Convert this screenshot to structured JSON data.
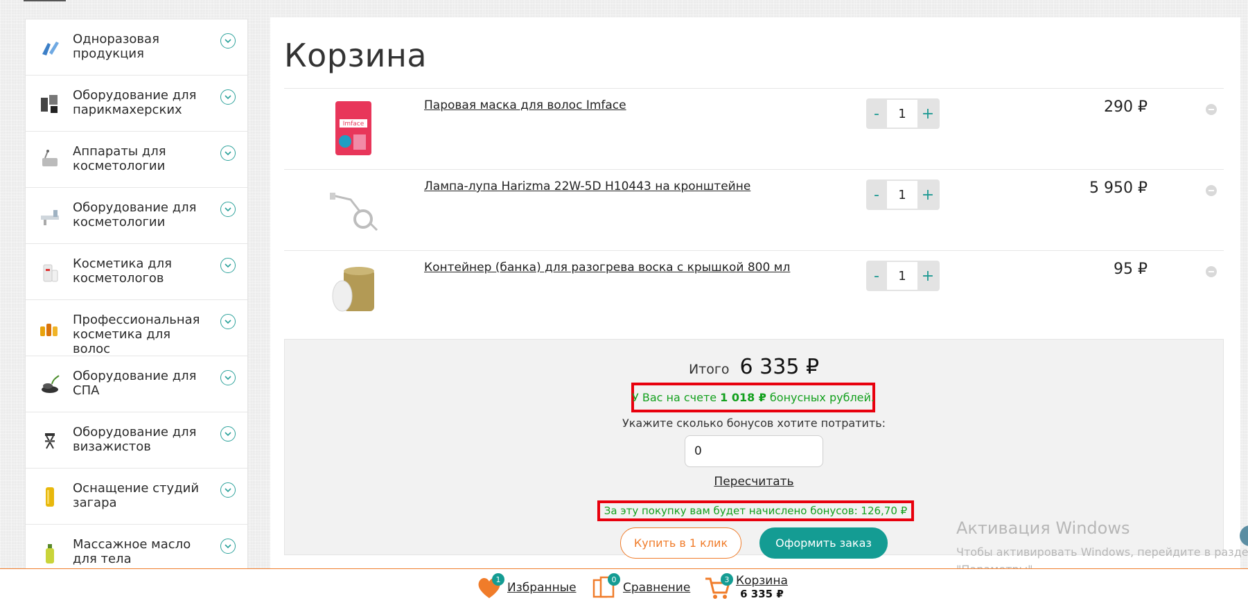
{
  "sidebar": {
    "categories": [
      {
        "label": "Одноразовая продукция",
        "icon": "gloves-icon"
      },
      {
        "label": "Оборудование для парикмахерских",
        "icon": "barber-equipment-icon"
      },
      {
        "label": "Аппараты для косметологии",
        "icon": "cosmetology-device-icon"
      },
      {
        "label": "Оборудование для косметологии",
        "icon": "cosmetology-chair-icon"
      },
      {
        "label": "Косметика для косметологов",
        "icon": "cosmetics-icon"
      },
      {
        "label": "Профессиональная косметика для волос",
        "icon": "hair-cosmetics-icon"
      },
      {
        "label": "Оборудование для СПА",
        "icon": "spa-icon"
      },
      {
        "label": "Оборудование для визажистов",
        "icon": "makeup-chair-icon"
      },
      {
        "label": "Оснащение студий загара",
        "icon": "tanning-icon"
      },
      {
        "label": "Массажное масло для тела",
        "icon": "oil-bottle-icon"
      }
    ]
  },
  "cart": {
    "title": "Корзина",
    "items": [
      {
        "name": "Паровая маска для волос Imface",
        "qty": "1",
        "price": "290 ₽",
        "image": "hair-mask-image"
      },
      {
        "name": "Лампа-лупа Harizma 22W-5D H10443 на кронштейне",
        "qty": "1",
        "price": "5 950 ₽",
        "image": "magnifier-lamp-image"
      },
      {
        "name": "Контейнер (банка) для разогрева воска с крышкой 800 мл",
        "qty": "1",
        "price": "95 ₽",
        "image": "wax-container-image"
      }
    ],
    "qty_minus": "-",
    "qty_plus": "+",
    "summary": {
      "total_label": "Итого",
      "total_value": "6 335 ₽",
      "bonus_prefix": "У Вас на счете",
      "bonus_amount": "1 018 ₽",
      "bonus_suffix": "бонусных рублей.",
      "bonus_hint": "Укажите сколько бонусов хотите потратить:",
      "bonus_input_value": "0",
      "recalc_label": "Пересчитать",
      "earn_text": "За эту покупку вам будет начислено бонусов: 126,70 ₽",
      "oneclick_label": "Купить в 1 клик",
      "order_label": "Оформить заказ"
    }
  },
  "watermark": {
    "title": "Активация Windows",
    "line1": "Чтобы активировать Windows, перейдите в раздел",
    "line2": "\"Параметры\"."
  },
  "bottombar": {
    "favorites": {
      "label": "Избранные",
      "count": "1"
    },
    "compare": {
      "label": "Сравнение",
      "count": "0"
    },
    "cart": {
      "label": "Корзина",
      "count": "3",
      "total": "6 335 ₽"
    }
  },
  "colors": {
    "accent": "#149c93",
    "orange": "#f07c2a",
    "highlight": "#e8000d",
    "bonus_text": "#13a01d"
  }
}
